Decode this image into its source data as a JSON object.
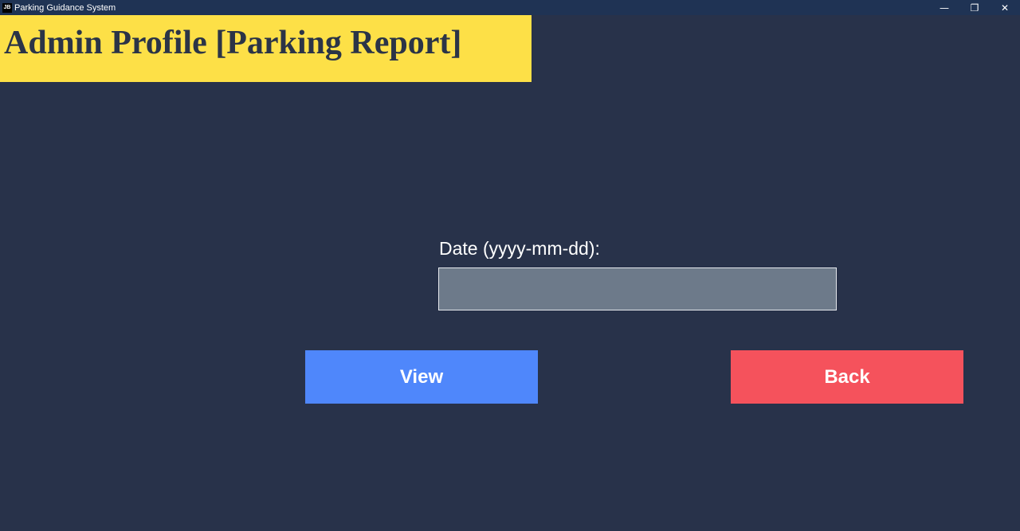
{
  "window": {
    "title": "Parking Guidance System",
    "icon_text": "JB",
    "controls": {
      "minimize": "—",
      "restore": "❐",
      "close": "✕"
    }
  },
  "header": {
    "title": "Admin Profile [Parking Report]"
  },
  "form": {
    "date_label": "Date (yyyy-mm-dd):",
    "date_value": "",
    "date_placeholder": ""
  },
  "buttons": {
    "view_label": "View",
    "back_label": "Back"
  },
  "colors": {
    "background": "#28324a",
    "banner": "#fde047",
    "view_button": "#4f87fb",
    "back_button": "#f5525c",
    "input_fill": "#6d7a8a"
  }
}
